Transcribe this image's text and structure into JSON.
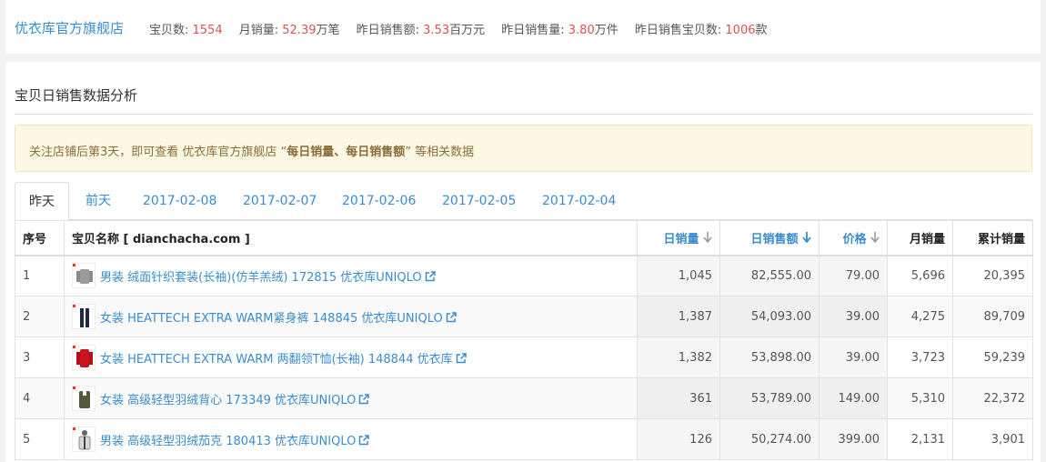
{
  "shop": {
    "name": "优衣库官方旗舰店",
    "stats": [
      {
        "label": "宝贝数: ",
        "value": "1554",
        "unit": ""
      },
      {
        "label": "月销量: ",
        "value": "52.39",
        "unit": "万笔"
      },
      {
        "label": "昨日销售额: ",
        "value": "3.53",
        "unit": "百万元"
      },
      {
        "label": "昨日销售量: ",
        "value": "3.80",
        "unit": "万件"
      },
      {
        "label": "昨日销售宝贝数: ",
        "value": "1006",
        "unit": "款"
      }
    ]
  },
  "panel": {
    "title": "宝贝日销售数据分析",
    "notice": {
      "prefix": "关注店铺后第3天，即可查看 优衣库官方旗舰店 “",
      "bold": "每日销量、每日销售额",
      "suffix": "” 等相关数据"
    }
  },
  "tabs": [
    "昨天",
    "前天",
    "2017-02-08",
    "2017-02-07",
    "2017-02-06",
    "2017-02-05",
    "2017-02-04"
  ],
  "table": {
    "headers": {
      "index": "序号",
      "name": "宝贝名称 [ dianchacha.com ]",
      "daily_qty": "日销量",
      "daily_sales": "日销售额",
      "price": "价格",
      "monthly": "月销量",
      "total": "累计销量"
    },
    "rows": [
      {
        "index": "1",
        "name": "男装 绒面针织套装(长袖)(仿羊羔绒) 172815 优衣库UNIQLO",
        "daily_qty": "1,045",
        "daily_sales": "82,555.00",
        "price": "79.00",
        "monthly": "5,696",
        "total": "20,395",
        "thumb": "gray-sweater"
      },
      {
        "index": "2",
        "name": "女装 HEATTECH EXTRA WARM紧身裤 148845 优衣库UNIQLO",
        "daily_qty": "1,387",
        "daily_sales": "54,093.00",
        "price": "39.00",
        "monthly": "4,275",
        "total": "89,709",
        "thumb": "navy-leggings"
      },
      {
        "index": "3",
        "name": "女装 HEATTECH EXTRA WARM 两翻领T恤(长袖) 148844 优衣库",
        "daily_qty": "1,382",
        "daily_sales": "53,898.00",
        "price": "39.00",
        "monthly": "3,723",
        "total": "59,239",
        "thumb": "red-turtleneck"
      },
      {
        "index": "4",
        "name": "女装 高级轻型羽绒背心 173349 优衣库UNIQLO",
        "daily_qty": "361",
        "daily_sales": "53,789.00",
        "price": "149.00",
        "monthly": "5,310",
        "total": "22,372",
        "thumb": "olive-vest"
      },
      {
        "index": "5",
        "name": "男装 高级轻型羽绒茄克 180413 优衣库UNIQLO",
        "daily_qty": "126",
        "daily_sales": "50,274.00",
        "price": "399.00",
        "monthly": "2,131",
        "total": "3,901",
        "thumb": "man-jacket"
      }
    ]
  },
  "colors": {
    "link": "#3a8ccf",
    "highlight": "#d9534f",
    "notice_bg": "#fcf8e3",
    "notice_text": "#8a6d3b"
  }
}
